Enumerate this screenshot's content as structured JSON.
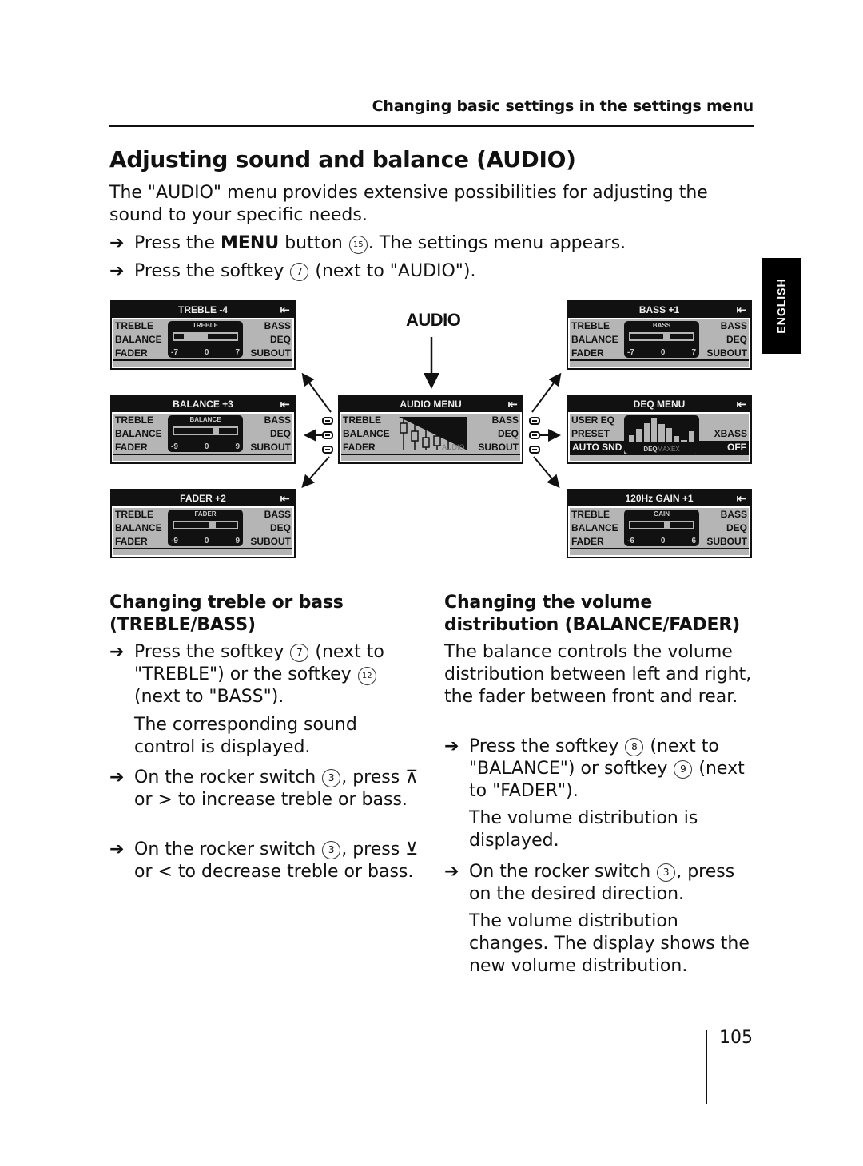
{
  "running_head": "Changing basic settings in the settings menu",
  "language_tab": "ENGLISH",
  "title": "Adjusting sound and balance (AUDIO)",
  "intro": "The \"AUDIO\" menu provides extensive possibilities for adjusting the sound to your specific needs.",
  "steps_top": [
    {
      "pre": "Press the ",
      "bold": "MENU",
      "mid": " button ",
      "ref": "15",
      "post": ". The settings menu appears."
    },
    {
      "pre": "Press the softkey ",
      "ref": "7",
      "post": " (next to \"AUDIO\")."
    }
  ],
  "arrow_glyph": "➔",
  "diagram": {
    "audio_label": "AUDIO",
    "back_glyph": "↵",
    "screens": {
      "treble": {
        "title": "TREBLE -4",
        "caption": "TREBLE",
        "left": [
          "TREBLE",
          "BALANCE",
          "FADER"
        ],
        "right": [
          "BASS",
          "DEQ",
          "SUBOUT"
        ],
        "ticks": [
          "-7",
          "0",
          "7"
        ],
        "value": -4,
        "range": 7
      },
      "balance": {
        "title": "BALANCE +3",
        "caption": "BALANCE",
        "left": [
          "TREBLE",
          "BALANCE",
          "FADER"
        ],
        "right": [
          "BASS",
          "DEQ",
          "SUBOUT"
        ],
        "ticks": [
          "-9",
          "0",
          "9"
        ],
        "value": 3,
        "range": 9
      },
      "fader": {
        "title": "FADER +2",
        "caption": "FADER",
        "left": [
          "TREBLE",
          "BALANCE",
          "FADER"
        ],
        "right": [
          "BASS",
          "DEQ",
          "SUBOUT"
        ],
        "ticks": [
          "-9",
          "0",
          "9"
        ],
        "value": 2,
        "range": 9
      },
      "audio_menu": {
        "title": "AUDIO MENU",
        "left": [
          "TREBLE",
          "BALANCE",
          "FADER"
        ],
        "right": [
          "BASS",
          "DEQ",
          "SUBOUT"
        ],
        "logo": "AUDIO"
      },
      "bass": {
        "title": "BASS  +1",
        "caption": "BASS",
        "left": [
          "TREBLE",
          "BALANCE",
          "FADER"
        ],
        "right": [
          "BASS",
          "DEQ",
          "SUBOUT"
        ],
        "ticks": [
          "-7",
          "0",
          "7"
        ],
        "value": 1,
        "range": 7
      },
      "deq": {
        "title": "DEQ MENU",
        "left": [
          "USER EQ",
          "PRESET",
          "AUTO SND"
        ],
        "right": [
          "",
          "XBASS",
          "OFF"
        ],
        "logo_bold": "DEQ",
        "logo_light": "MAXEX",
        "eq_levels": [
          0.3,
          0.55,
          0.8,
          1.0,
          0.78,
          0.6,
          0.25,
          0.1,
          0.45
        ]
      },
      "gain": {
        "title": "120Hz    GAIN  +1",
        "caption": "GAIN",
        "left": [
          "TREBLE",
          "BALANCE",
          "FADER"
        ],
        "right": [
          "BASS",
          "DEQ",
          "SUBOUT"
        ],
        "ticks": [
          "-6",
          "0",
          "6"
        ],
        "value": 1,
        "range": 6
      }
    }
  },
  "left_col": {
    "heading": "Changing treble or bass (TREBLE/BASS)",
    "step1": {
      "pre": "Press the softkey ",
      "ref1": "7",
      "mid": " (next to \"TREBLE\") or the softkey ",
      "ref2": "12",
      "post": " (next to \"BASS\")."
    },
    "result1": "The corresponding sound control is displayed.",
    "step2": {
      "pre": "On the rocker switch ",
      "ref": "3",
      "post1": ", press ",
      "sym1": "⊼",
      "mid": " or > to increase treble or bass."
    },
    "step3": {
      "pre": "On the rocker switch ",
      "ref": "3",
      "post1": ", press ",
      "sym1": "⊻",
      "mid": " or < to decrease treble or bass."
    }
  },
  "right_col": {
    "heading": "Changing the volume distribution (BALANCE/FADER)",
    "para": "The balance controls the volume distribution between left and right, the fader between front and rear.",
    "step1": {
      "pre": "Press the softkey ",
      "ref1": "8",
      "mid": " (next to \"BALANCE\") or softkey ",
      "ref2": "9",
      "post": " (next to \"FADER\")."
    },
    "result1": "The volume distribution is displayed.",
    "step2": {
      "pre": "On the rocker switch ",
      "ref": "3",
      "post": ", press on the desired direction."
    },
    "result2": "The volume distribution changes. The display shows the new volume distribution."
  },
  "page_number": "105"
}
